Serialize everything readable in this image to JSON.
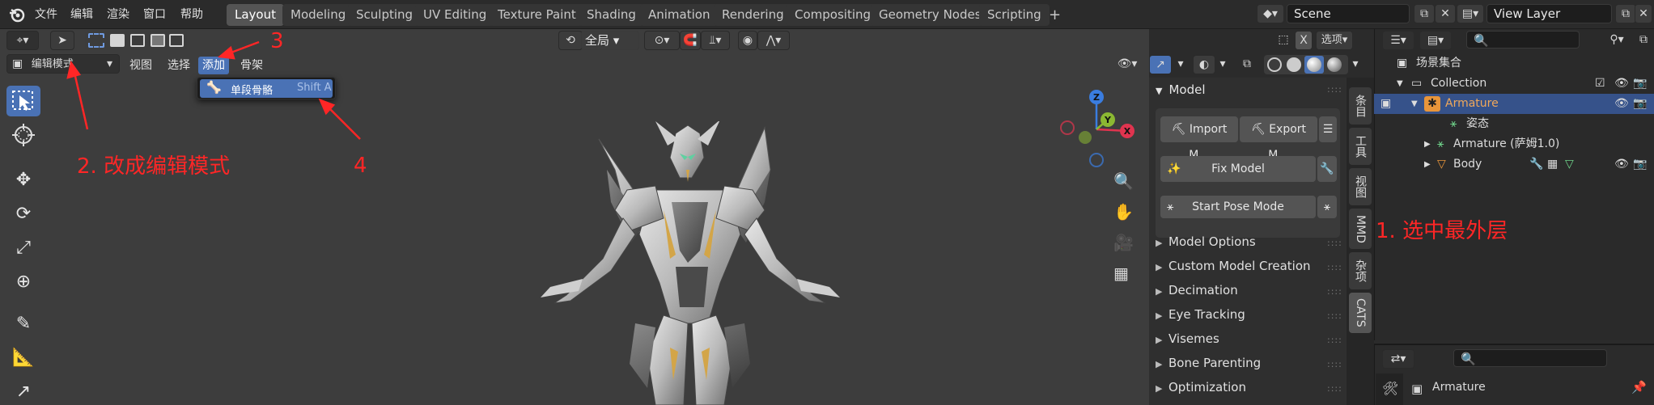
{
  "topbar": {
    "menus": [
      "文件",
      "编辑",
      "渲染",
      "窗口",
      "帮助"
    ],
    "workspaces": [
      "Layout",
      "Modeling",
      "Sculpting",
      "UV Editing",
      "Texture Paint",
      "Shading",
      "Animation",
      "Rendering",
      "Compositing",
      "Geometry Nodes",
      "Scripting"
    ],
    "add_tab": "+",
    "scene": "Scene",
    "view_layer": "View Layer"
  },
  "header": {
    "mode": "编辑模式",
    "menus": [
      "视图",
      "选择",
      "添加",
      "骨架"
    ],
    "transform_orientation": "全局",
    "x_toggle": "X",
    "options": "选项"
  },
  "dropdown": {
    "item_label": "单段骨骼",
    "item_shortcut": "Shift A"
  },
  "annotations": {
    "step1": "1. 选中最外层",
    "step2": "2. 改成编辑模式",
    "step3": "3",
    "step4": "4",
    "color": "#ff2626"
  },
  "npanel": {
    "header": "Model",
    "buttons": {
      "import": "Import M...",
      "export": "Export M...",
      "fix": "Fix Model",
      "pose": "Start Pose Mode"
    },
    "sections": [
      "Model Options",
      "Custom Model Creation",
      "Decimation",
      "Eye Tracking",
      "Visemes",
      "Bone Parenting",
      "Optimization"
    ],
    "tabs": [
      "条目",
      "工具",
      "视图",
      "MMD",
      "杂项",
      "CATS"
    ]
  },
  "outliner": {
    "root": "场景集合",
    "collection": "Collection",
    "armature": "Armature",
    "pose": "姿态",
    "armature_data": "Armature (萨姆1.0)",
    "body": "Body"
  },
  "properties": {
    "object_name": "Armature"
  },
  "colors": {
    "accent": "#4a72b5",
    "selection_row": "#36528a",
    "armature_orange": "#e8953a",
    "gizmo_x": "#e0344f",
    "gizmo_y": "#8bb832",
    "gizmo_z": "#3a7de0"
  }
}
